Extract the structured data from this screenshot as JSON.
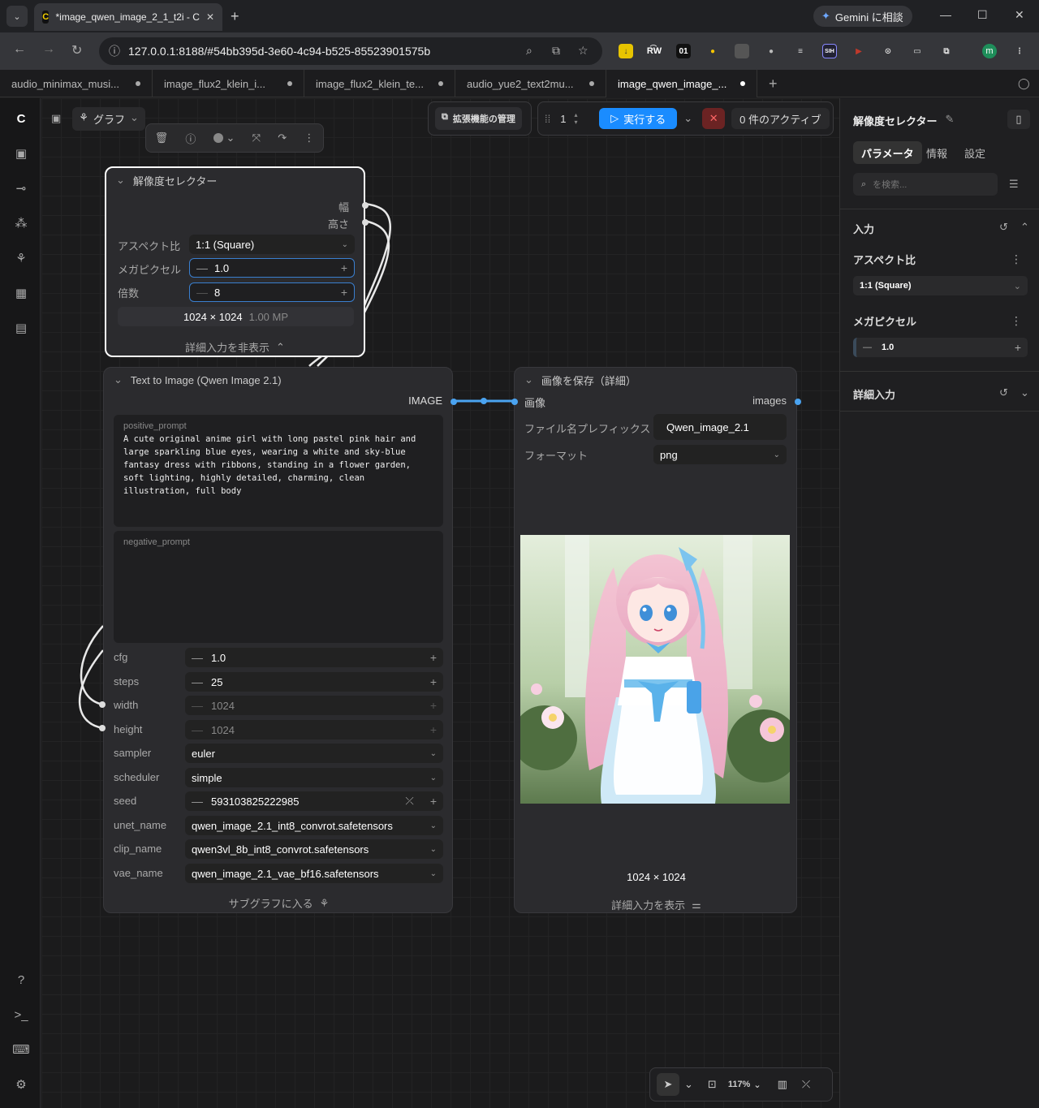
{
  "browser": {
    "tab_title": "*image_qwen_image_2_1_t2i - C",
    "tab_close": "✕",
    "new_tab": "+",
    "url": "127.0.0.1:8188/#54bb395d-3e60-4c94-b525-85523901575b",
    "gemini_label": "Gemini に相談",
    "ext_01": "01",
    "ext_rw": "R͡W",
    "profile_initial": "m"
  },
  "app_tabs": [
    {
      "label": "audio_minimax_musi..."
    },
    {
      "label": "image_flux2_klein_i..."
    },
    {
      "label": "image_flux2_klein_te..."
    },
    {
      "label": "audio_yue2_text2mu..."
    },
    {
      "label": "image_qwen_image_..."
    }
  ],
  "topbar": {
    "graph_label": "グラフ",
    "extensions_label": "拡張機能の管理",
    "queue_count": "1",
    "run_label": "実行する",
    "active_label": "0 件のアクティブ"
  },
  "node_resolution": {
    "title": "解像度セレクター",
    "out_width": "幅",
    "out_height": "高さ",
    "aspect_label": "アスペクト比",
    "aspect_value": "1:1 (Square)",
    "mp_label": "メガピクセル",
    "mp_value": "1.0",
    "mult_label": "倍数",
    "mult_value": "8",
    "size_text": "1024 × 1024",
    "mp_text": "1.00 MP",
    "hide_adv": "詳細入力を非表示"
  },
  "node_t2i": {
    "title": "Text to Image (Qwen Image 2.1)",
    "output": "IMAGE",
    "pos_label": "positive_prompt",
    "pos_text": "A cute original anime girl with long pastel pink hair and large sparkling blue eyes, wearing a white and sky-blue fantasy dress with ribbons, standing in a flower garden, soft lighting, highly detailed, charming, clean illustration, full body",
    "neg_label": "negative_prompt",
    "params": [
      {
        "label": "cfg",
        "value": "1.0",
        "kind": "num"
      },
      {
        "label": "steps",
        "value": "25",
        "kind": "num"
      },
      {
        "label": "width",
        "value": "1024",
        "kind": "dim"
      },
      {
        "label": "height",
        "value": "1024",
        "kind": "dim"
      },
      {
        "label": "sampler",
        "value": "euler",
        "kind": "combo"
      },
      {
        "label": "scheduler",
        "value": "simple",
        "kind": "combo"
      },
      {
        "label": "seed",
        "value": "593103825222985",
        "kind": "seed"
      },
      {
        "label": "unet_name",
        "value": "qwen_image_2.1_int8_convrot.safetensors",
        "kind": "combo"
      },
      {
        "label": "clip_name",
        "value": "qwen3vl_8b_int8_convrot.safetensors",
        "kind": "combo"
      },
      {
        "label": "vae_name",
        "value": "qwen_image_2.1_vae_bf16.safetensors",
        "kind": "combo"
      }
    ],
    "subgraph_label": "サブグラフに入る"
  },
  "node_save": {
    "title": "画像を保存（詳細）",
    "input_label": "画像",
    "output_label": "images",
    "prefix_label": "ファイル名プレフィックス",
    "prefix_value": "Qwen_image_2.1",
    "format_label": "フォーマット",
    "format_value": "png",
    "image_size": "1024 × 1024",
    "show_adv": "詳細入力を表示"
  },
  "bottom": {
    "zoom": "117%"
  },
  "right_panel": {
    "title": "解像度セレクター",
    "tabs": [
      "パラメータ",
      "情報",
      "設定"
    ],
    "search_placeholder": "を検索...",
    "section_inputs": "入力",
    "aspect_label": "アスペクト比",
    "aspect_value": "1:1 (Square)",
    "mp_label": "メガピクセル",
    "mp_value": "1.0",
    "section_adv": "詳細入力"
  },
  "colors": {
    "accent": "#1a8cff",
    "link": "#4aa3f0",
    "canvas": "#1b1b1c"
  }
}
